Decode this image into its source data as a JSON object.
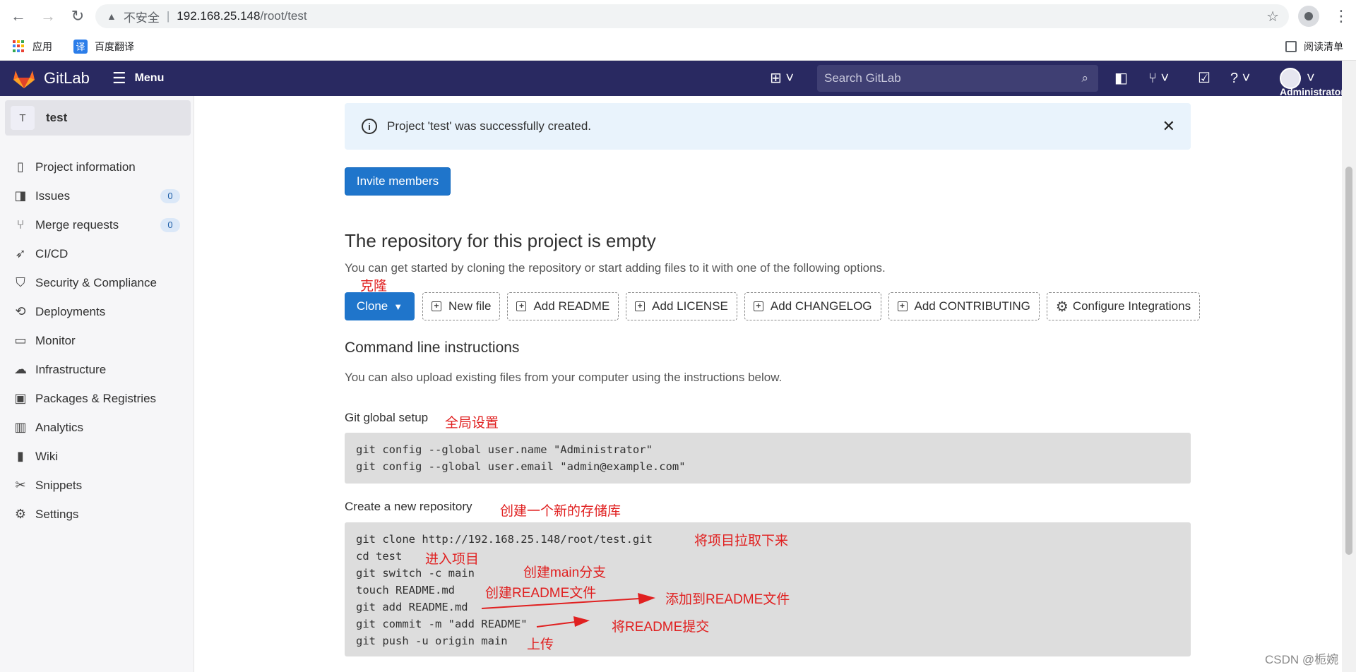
{
  "browser": {
    "insecure_label": "不安全",
    "url_host": "192.168.25.148",
    "url_path": "/root/test",
    "bookmarks": [
      {
        "label": "应用"
      },
      {
        "label": "百度翻译",
        "icon_text": "译"
      }
    ],
    "reading_list": "阅读清单"
  },
  "header": {
    "brand": "GitLab",
    "menu_label": "Menu",
    "search_placeholder": "Search GitLab",
    "user_label": "Administrator"
  },
  "sidebar": {
    "project_initial": "T",
    "project_name": "test",
    "items": [
      {
        "label": "Project information",
        "icon": "project-icon"
      },
      {
        "label": "Issues",
        "icon": "issues-icon",
        "badge": "0"
      },
      {
        "label": "Merge requests",
        "icon": "merge-request-icon",
        "badge": "0"
      },
      {
        "label": "CI/CD",
        "icon": "rocket-icon"
      },
      {
        "label": "Security & Compliance",
        "icon": "shield-icon"
      },
      {
        "label": "Deployments",
        "icon": "deployments-icon"
      },
      {
        "label": "Monitor",
        "icon": "monitor-icon"
      },
      {
        "label": "Infrastructure",
        "icon": "cloud-icon"
      },
      {
        "label": "Packages & Registries",
        "icon": "package-icon"
      },
      {
        "label": "Analytics",
        "icon": "chart-icon"
      },
      {
        "label": "Wiki",
        "icon": "book-icon"
      },
      {
        "label": "Snippets",
        "icon": "scissors-icon"
      },
      {
        "label": "Settings",
        "icon": "gear-icon"
      }
    ]
  },
  "main": {
    "alert_text": "Project 'test' was successfully created.",
    "invite_label": "Invite members",
    "empty_title": "The repository for this project is empty",
    "empty_desc": "You can get started by cloning the repository or start adding files to it with one of the following options.",
    "clone_label": "Clone",
    "actions": [
      "New file",
      "Add README",
      "Add LICENSE",
      "Add CHANGELOG",
      "Add CONTRIBUTING",
      "Configure Integrations"
    ],
    "cmd_title": "Command line instructions",
    "cmd_desc": "You can also upload existing files from your computer using the instructions below.",
    "global_setup_title": "Git global setup",
    "global_setup_lines": [
      "git config --global user.name \"Administrator\"",
      "git config --global user.email \"admin@example.com\""
    ],
    "new_repo_title": "Create a new repository",
    "new_repo_lines": [
      "git clone http://192.168.25.148/root/test.git",
      "cd test",
      "git switch -c main",
      "touch README.md",
      "git add README.md",
      "git commit -m \"add README\"",
      "git push -u origin main"
    ]
  },
  "annotations": {
    "clone": "克隆",
    "global": "全局设置",
    "new_repo": "创建一个新的存储库",
    "pull": "将项目拉取下来",
    "enter": "进入项目",
    "branch": "创建main分支",
    "create_readme": "创建README文件",
    "add_readme": "添加到README文件",
    "commit_readme": "将README提交",
    "upload": "上传"
  },
  "watermark": "CSDN @栀婉",
  "colors": {
    "header_bg": "#292961",
    "primary": "#1f75cb",
    "annotation": "#e02020",
    "alert_bg": "#e9f3fc"
  }
}
